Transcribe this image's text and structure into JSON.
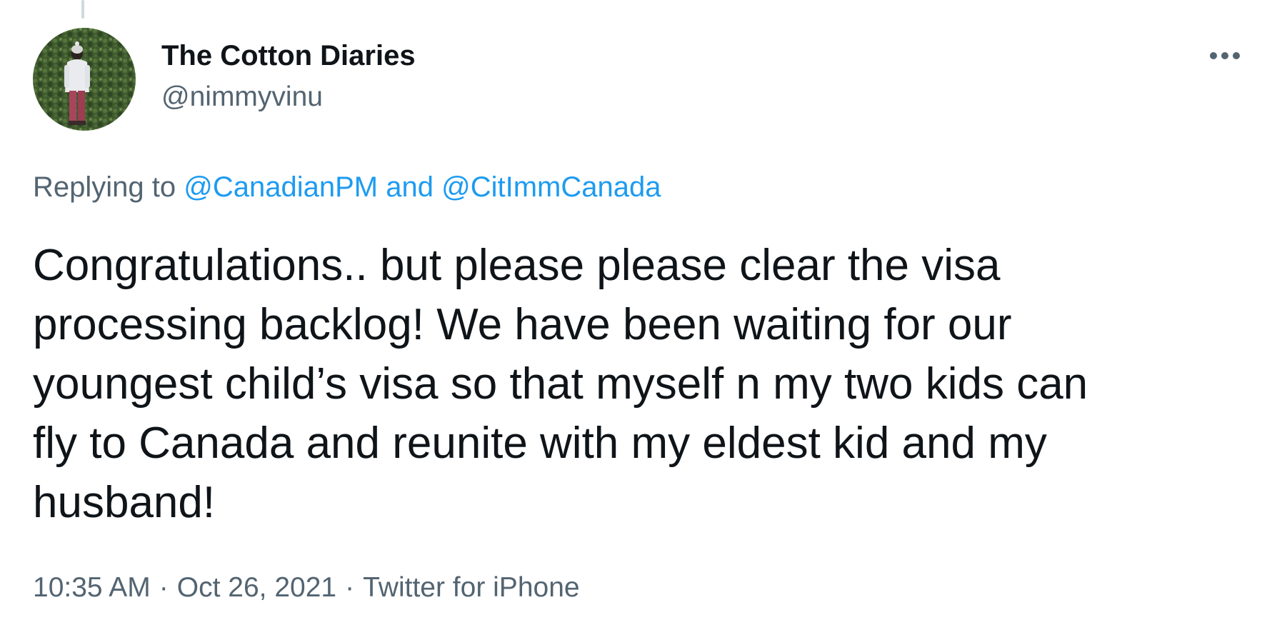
{
  "author": {
    "display_name": "The Cotton Diaries",
    "handle": "@nimmyvinu",
    "avatar_icon": "profile-photo"
  },
  "more_icon": "more-horizontal-icon",
  "reply_context": {
    "prefix": "Replying to",
    "mention_1": "@CanadianPM",
    "conjunction": "and",
    "mention_2": "@CitImmCanada"
  },
  "tweet": {
    "text": "Congratulations.. but please please clear the visa\nprocessing backlog! We have been waiting for our\nyoungest child’s visa so that myself n my two kids can\nfly to Canada and reunite with my eldest kid and my\nhusband!"
  },
  "meta": {
    "time": "10:35 AM",
    "date": "Oct 26, 2021",
    "separator": "·",
    "source": "Twitter for iPhone"
  },
  "colors": {
    "text_primary": "#0f1419",
    "text_secondary": "#536471",
    "link": "#1d9bf0"
  }
}
